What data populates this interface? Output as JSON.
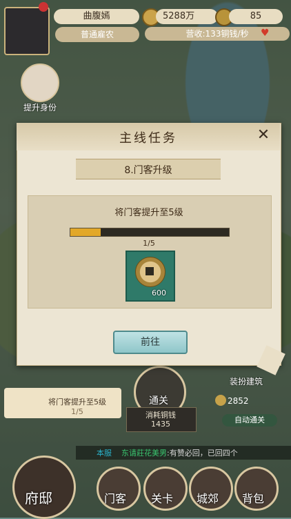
{
  "header": {
    "player_name": "曲腹嫣",
    "rank": "普通雇农",
    "money": "5288万",
    "gold": "85",
    "income": "营收:133铜钱/秒",
    "heart_level": "0%"
  },
  "side": {
    "promote_label": "提升身份"
  },
  "modal": {
    "title": "主线任务",
    "close_icon": "close-icon",
    "quest_name": "8.门客升级",
    "description": "将门客提升至5级",
    "progress": {
      "current": 1,
      "total": 5,
      "label": "1/5"
    },
    "reward_icon": "copper-coin-icon",
    "reward_amount": "600",
    "go_button": "前往"
  },
  "bottom": {
    "quest_tracker": {
      "text": "将门客提升至5级",
      "progress": "1/5"
    },
    "pass_label": "通关",
    "pass_cost_label": "消耗铜钱",
    "pass_cost": "1435",
    "decorate_label": "装扮建筑",
    "decorate_cost": "2852",
    "auto_pass": "自动通关",
    "chat": {
      "tag": "本服",
      "name": "东请莊花美男",
      "message": ":有赞必回，已回四个"
    },
    "nav": {
      "home": "府邸",
      "retainer": "门客",
      "level": "关卡",
      "city": "城郊",
      "bag": "背包"
    }
  }
}
